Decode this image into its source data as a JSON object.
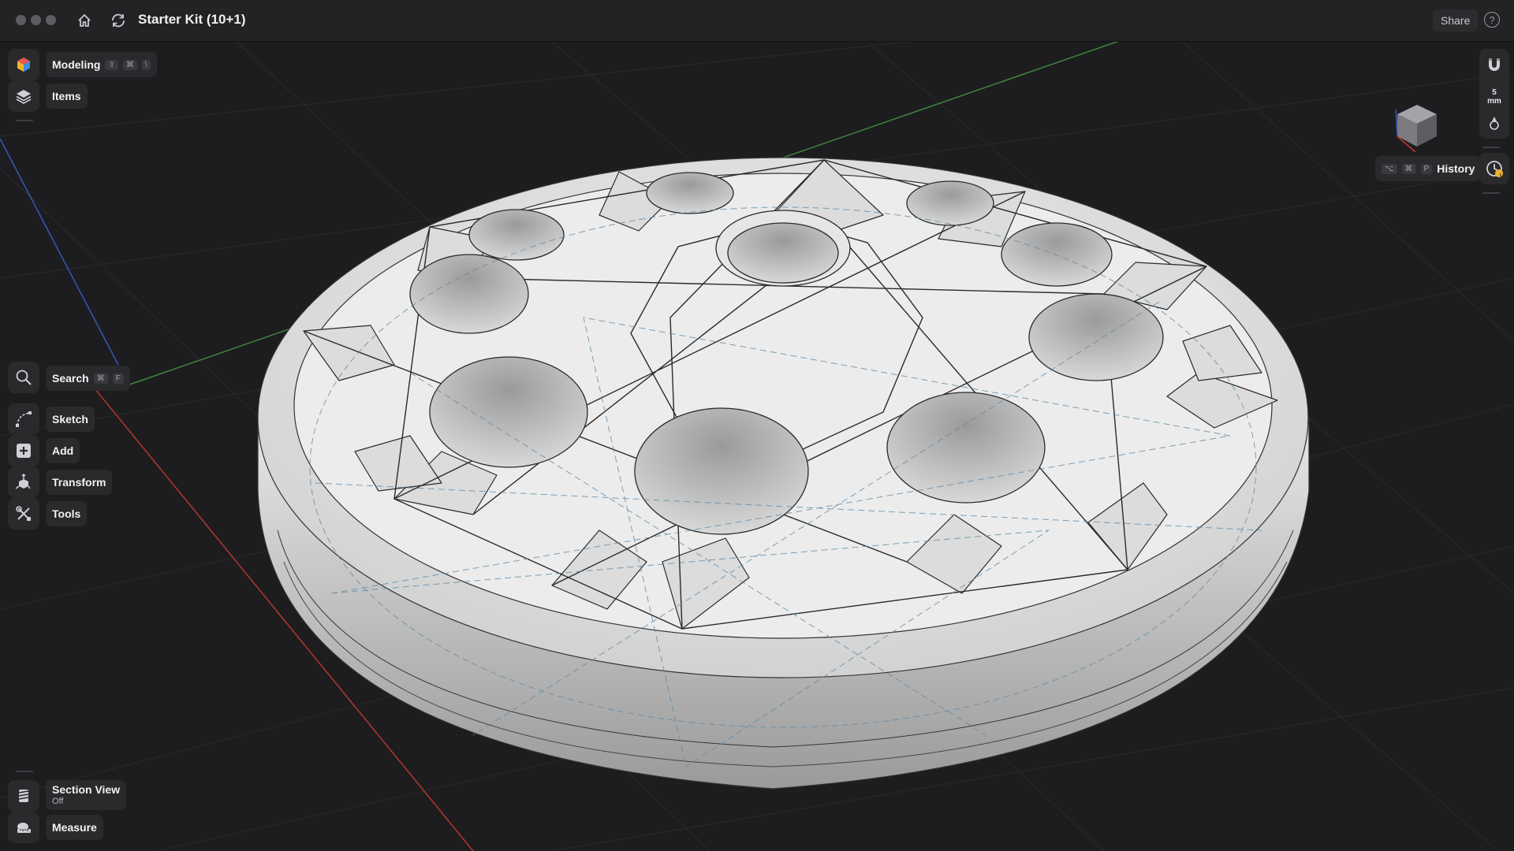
{
  "window": {
    "title": "Starter Kit (10+1)",
    "share_label": "Share",
    "help_label": "?"
  },
  "left_panel": {
    "workspace": {
      "label": "Modeling",
      "shortcut": [
        "⇧",
        "⌘",
        "\\"
      ],
      "icon": "modeling-cube-icon"
    },
    "items": {
      "label": "Items",
      "icon": "layers-icon"
    },
    "search": {
      "label": "Search",
      "shortcut": [
        "⌘",
        "F"
      ],
      "icon": "search-icon"
    },
    "tools": [
      {
        "label": "Sketch",
        "icon": "sketch-icon"
      },
      {
        "label": "Add",
        "icon": "add-icon"
      },
      {
        "label": "Transform",
        "icon": "transform-icon"
      },
      {
        "label": "Tools",
        "icon": "tools-icon"
      }
    ],
    "section_view": {
      "label": "Section View",
      "status": "Off",
      "icon": "section-view-icon"
    },
    "measure": {
      "label": "Measure",
      "icon": "measure-icon"
    }
  },
  "right_panel": {
    "snap_icon": "magnet-icon",
    "grid_size": {
      "value": "5",
      "unit": "mm"
    },
    "gizmo_icon": "pivot-icon",
    "history": {
      "label": "History",
      "shortcut": [
        "⌥",
        "⌘",
        "P"
      ],
      "icon": "history-clock-icon",
      "badge": "!"
    },
    "view_cube_icon": "view-cube-icon"
  },
  "colors": {
    "accent_badge": "#f0b429",
    "x_axis": "#b3372f",
    "y_axis": "#3d8a3d",
    "z_axis": "#3559b8"
  }
}
